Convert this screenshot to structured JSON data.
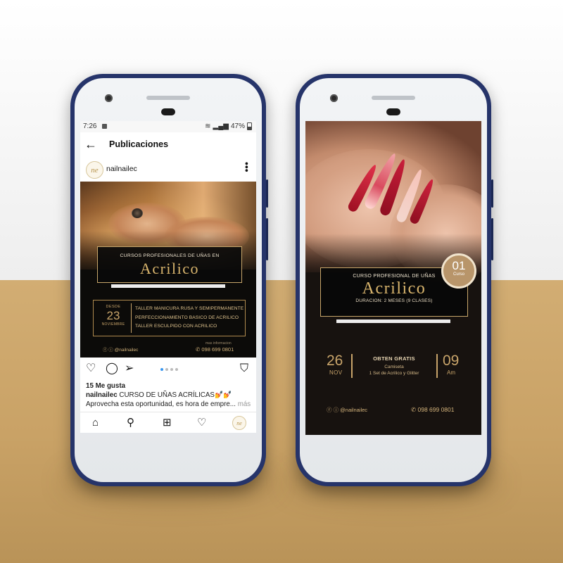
{
  "colors": {
    "phone_frame": "#26346a",
    "background_top": "#f0f0f0",
    "background_bottom": "#c9a266",
    "gold_accent": "#d9b56d",
    "post_background": "#0c0b09",
    "instagram_blue": "#3897f0"
  },
  "phone1": {
    "status": {
      "time": "7:26",
      "battery": "47%"
    },
    "appbar": {
      "back_icon": "arrow-left-icon",
      "title": "Publicaciones"
    },
    "post": {
      "avatar_text": "ne",
      "username": "nailnailec",
      "menu_icon": "more-vertical-icon",
      "headline_small": "CURSOS PROFESIONALES DE UÑAS EN",
      "headline_big": "Acrilico",
      "date": {
        "desde": "DESDE",
        "day": "23",
        "month": "NOVIEMBRE"
      },
      "courses": [
        "TALLER MANICURA RUSA Y SEMIPERMANENTE",
        "PERFECCIONAMIENTO BASICO DE ACRILICO",
        "TALLER ESCULPIDO CON ACRILICO"
      ],
      "social_handle": "@nailnailec",
      "more_info": "mas informacion",
      "phone_number": "098 699 0801"
    },
    "actions": {
      "like_icon": "heart-icon",
      "comment_icon": "comment-icon",
      "share_icon": "send-icon",
      "save_icon": "bookmark-icon",
      "carousel_count": 4,
      "carousel_active": 1
    },
    "caption": {
      "likes": "15 Me gusta",
      "username": "nailnailec",
      "text": "CURSO DE UÑAS ACRÍLICAS💅💅",
      "line2": "Aprovecha esta oportunidad, es hora de empre...",
      "more": "más"
    },
    "nav": {
      "home_icon": "home-icon",
      "search_icon": "search-icon",
      "add_icon": "add-post-icon",
      "activity_icon": "heart-icon",
      "profile_icon": "avatar"
    }
  },
  "phone2": {
    "badge": {
      "number": "01",
      "label": "Curso"
    },
    "headline_small": "CURSO PROFESIONAL DE UÑAS",
    "headline_big": "Acrilico",
    "duration": "DURACION: 2 MESES (9 CLASES)",
    "date": {
      "day": "26",
      "month": "NOV"
    },
    "gift": {
      "title": "OBTEN GRATIS",
      "line1": "Camiseta",
      "line2": "1 Set de Acrilico y Glitter"
    },
    "time": {
      "hour": "09",
      "period": "Am"
    },
    "social_handle": "@nailnailec",
    "phone_number": "098 699 0801"
  }
}
